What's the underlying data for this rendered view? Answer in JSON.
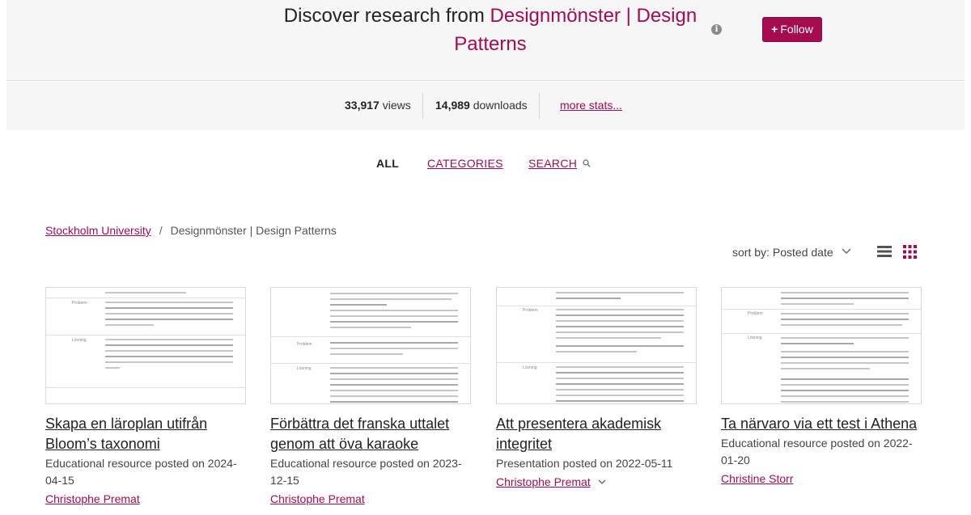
{
  "header": {
    "title_prefix": "Discover research from ",
    "title_group": "Designmönster | Design Patterns",
    "info_icon": "info-icon",
    "follow_plus": "+",
    "follow_label": "Follow"
  },
  "stats": {
    "views_value": "33,917",
    "views_label": " views",
    "downloads_value": "14,989",
    "downloads_label": " downloads",
    "more_stats": "more stats..."
  },
  "tabs": {
    "all": "ALL",
    "categories": "CATEGORIES",
    "search": "SEARCH"
  },
  "breadcrumb": {
    "parent": "Stockholm University",
    "separator": "/",
    "current": "Designmönster | Design Patterns"
  },
  "sort": {
    "label": "sort by:",
    "value": "Posted date"
  },
  "colors": {
    "accent": "#a50b4f",
    "panel_bg": "#f6f6f6"
  },
  "items": [
    {
      "title": "Skapa en läroplan utifrån Bloom’s taxonomi",
      "meta": "Educational resource posted on 2024-04-15",
      "author": "Christophe Premat",
      "thumb_labels": [
        "Problem",
        "Lösning"
      ]
    },
    {
      "title": "Förbättra det franska uttalet genom att öva karaoke",
      "meta": "Educational resource posted on 2023-12-15",
      "author": "Christophe Premat",
      "thumb_labels": [
        "Problem",
        "Lösning"
      ]
    },
    {
      "title": "Att presentera akademisk integritet",
      "meta": "Presentation posted on 2022-05-11",
      "author": "Christophe Premat",
      "thumb_labels": [
        "Problem",
        "Lösning"
      ]
    },
    {
      "title": "Ta närvaro via ett test i Athena",
      "meta": "Educational resource posted on 2022-01-20",
      "author": "Christine Storr",
      "thumb_labels": [
        "Problem",
        "Lösning"
      ]
    }
  ]
}
